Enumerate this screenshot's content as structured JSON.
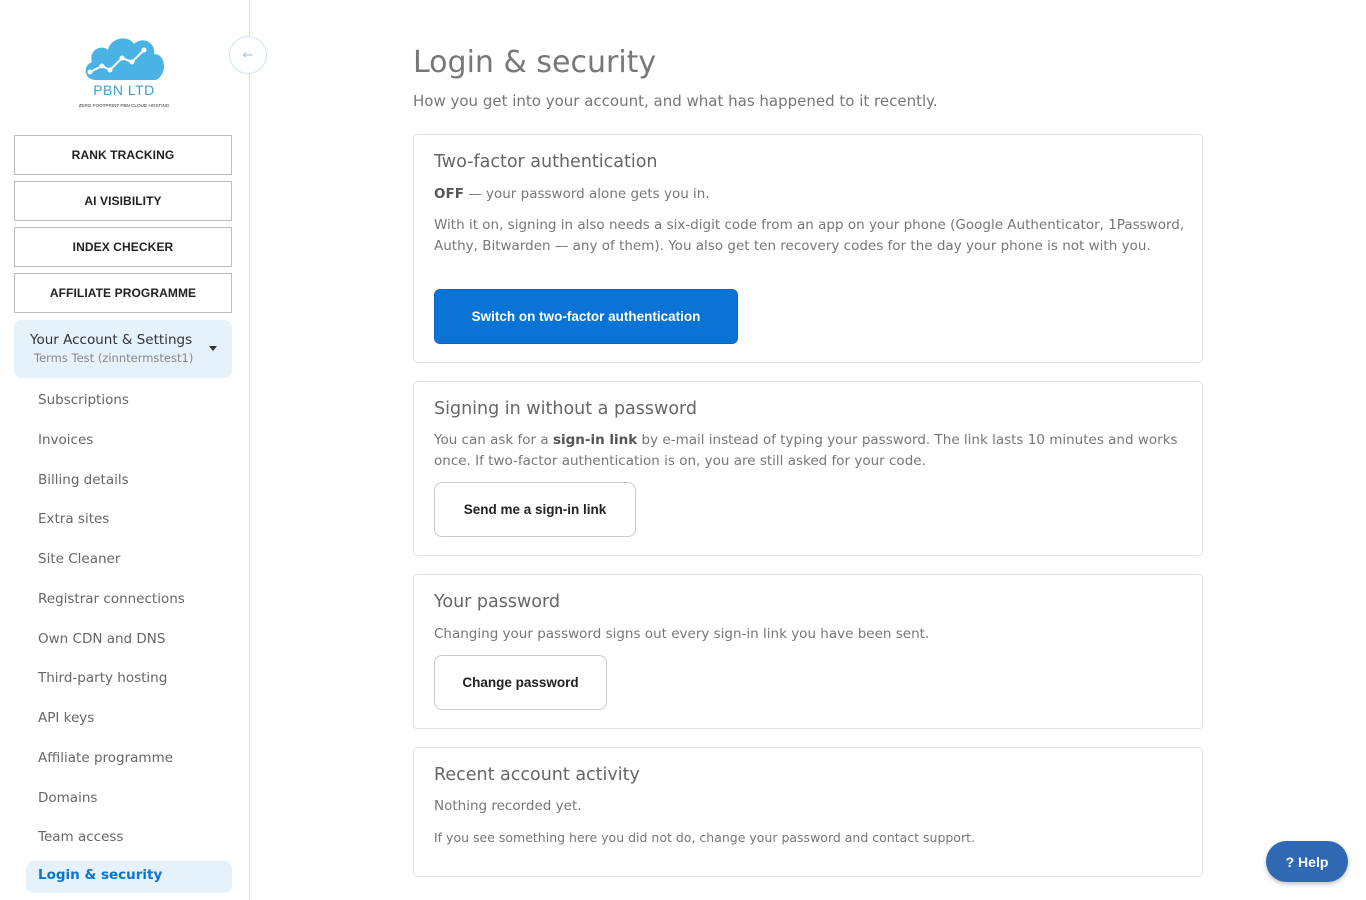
{
  "brand": {
    "name": "PBN LTD",
    "tagline": "ZERO FOOTPRINT PBN CLOUD HOSTING",
    "cloud_color": "#4ab3e6"
  },
  "sidebar": {
    "collapse_icon": "←",
    "nav_buttons": [
      {
        "label": "RANK TRACKING"
      },
      {
        "label": "AI VISIBILITY"
      },
      {
        "label": "INDEX CHECKER"
      },
      {
        "label": "AFFILIATE PROGRAMME"
      }
    ],
    "account": {
      "title": "Your Account & Settings",
      "user": "Terms Test (zinntermstest1)"
    },
    "sub_items": [
      {
        "label": "Subscriptions"
      },
      {
        "label": "Invoices"
      },
      {
        "label": "Billing details"
      },
      {
        "label": "Extra sites"
      },
      {
        "label": "Site Cleaner"
      },
      {
        "label": "Registrar connections"
      },
      {
        "label": "Own CDN and DNS"
      },
      {
        "label": "Third-party hosting"
      },
      {
        "label": "API keys"
      },
      {
        "label": "Affiliate programme"
      },
      {
        "label": "Domains"
      },
      {
        "label": "Team access"
      }
    ],
    "active_item": "Login & security"
  },
  "main": {
    "title": "Login & security",
    "subtitle": "How you get into your account, and what has happened to it recently.",
    "two_factor": {
      "title": "Two-factor authentication",
      "status": "OFF",
      "status_text": " — your password alone gets you in.",
      "description": "With it on, signing in also needs a six-digit code from an app on your phone (Google Authenticator, 1Password, Authy, Bitwarden — any of them). You also get ten recovery codes for the day your phone is not with you.",
      "button": "Switch on two-factor authentication"
    },
    "passwordless": {
      "title": "Signing in without a password",
      "text_before": "You can ask for a ",
      "text_bold": "sign-in link",
      "text_after": " by e-mail instead of typing your password. The link lasts 10 minutes and works once. If two-factor authentication is on, you are still asked for your code.",
      "button": "Send me a sign-in link"
    },
    "password": {
      "title": "Your password",
      "text": "Changing your password signs out every sign-in link you have been sent.",
      "button": "Change password"
    },
    "activity": {
      "title": "Recent account activity",
      "empty": "Nothing recorded yet.",
      "note": "If you see something here you did not do, change your password and contact support."
    }
  },
  "help": {
    "label": "? Help"
  },
  "colors": {
    "accent": "#0a74d6",
    "active_bg": "#e5f1fb",
    "help_bg": "#2f69b3"
  }
}
